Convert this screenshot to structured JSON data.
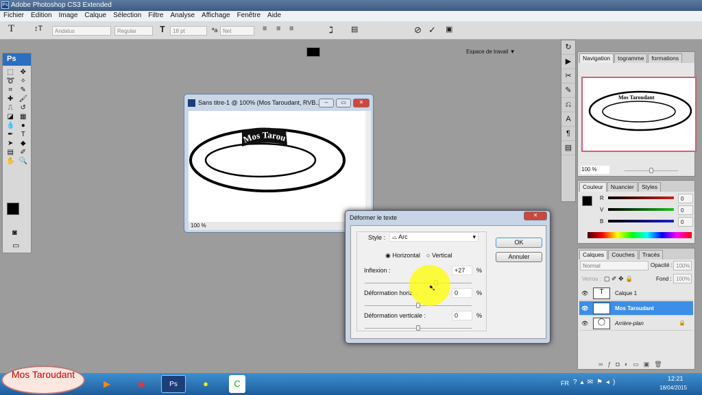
{
  "app": {
    "title": "Adobe Photoshop CS3 Extended",
    "logo": "Ps"
  },
  "menu": [
    "Fichier",
    "Edition",
    "Image",
    "Calque",
    "Sélection",
    "Filtre",
    "Analyse",
    "Affichage",
    "Fenêtre",
    "Aide"
  ],
  "options": {
    "font_family": "Andalus",
    "font_style": "Regular",
    "font_size": "18 pt",
    "antialias": "Net",
    "workspace": "Espace de travail ▼",
    "text_color": "#000000"
  },
  "toolbox": {
    "header": "Ps",
    "tools": [
      "marquee-icon",
      "move-icon",
      "lasso-icon",
      "magic-wand-icon",
      "crop-icon",
      "slice-icon",
      "healing-icon",
      "brush-icon",
      "stamp-icon",
      "history-brush-icon",
      "eraser-icon",
      "gradient-icon",
      "blur-icon",
      "dodge-icon",
      "pen-icon",
      "type-icon",
      "path-select-icon",
      "shape-icon",
      "notes-icon",
      "eyedropper-icon",
      "hand-icon",
      "zoom-icon"
    ]
  },
  "document": {
    "title": "Sans titre-1 @ 100% (Mos Taroudant, RVB...",
    "zoom": "100 %",
    "text": "Mos Taroudant"
  },
  "dialog": {
    "title": "Déformer le texte",
    "style_label": "Style :",
    "style_value": "Arc",
    "horizontal": "Horizontal",
    "vertical": "Vertical",
    "orientation": "horizontal",
    "inflexion_label": "Inflexion :",
    "inflexion": "+27",
    "hdist_label": "Déformation horiz. :",
    "hdist": "0",
    "vdist_label": "Déformation verticale :",
    "vdist": "0",
    "percent": "%",
    "ok": "OK",
    "cancel": "Annuler"
  },
  "navigator": {
    "tabs": [
      "Navigation",
      "togramme",
      "formations"
    ],
    "zoom": "100 %",
    "preview_text": "Mos Taroudant"
  },
  "color": {
    "tabs": [
      "Couleur",
      "Nuancier",
      "Styles"
    ],
    "channels": [
      {
        "label": "R",
        "value": "0",
        "color": "#cc2020"
      },
      {
        "label": "V",
        "value": "0",
        "color": "#20c020"
      },
      {
        "label": "B",
        "value": "0",
        "color": "#2020cc"
      }
    ]
  },
  "layers": {
    "tabs": [
      "Calques",
      "Couches",
      "Tracés"
    ],
    "blend": "Normal",
    "opacity_label": "Opacité :",
    "opacity": "100%",
    "lock_label": "Verrou :",
    "fill_label": "Fond :",
    "fill": "100%",
    "items": [
      {
        "name": "Calque 1",
        "thumb": "T"
      },
      {
        "name": "Mos Taroudant",
        "thumb": "⚲",
        "selected": true
      },
      {
        "name": "Arrière-plan",
        "thumb": "◯",
        "locked": true
      }
    ]
  },
  "taskbar": {
    "brand": "Mos Taroudant",
    "lang": "FR",
    "time": "12:21",
    "date": "18/04/2015"
  }
}
